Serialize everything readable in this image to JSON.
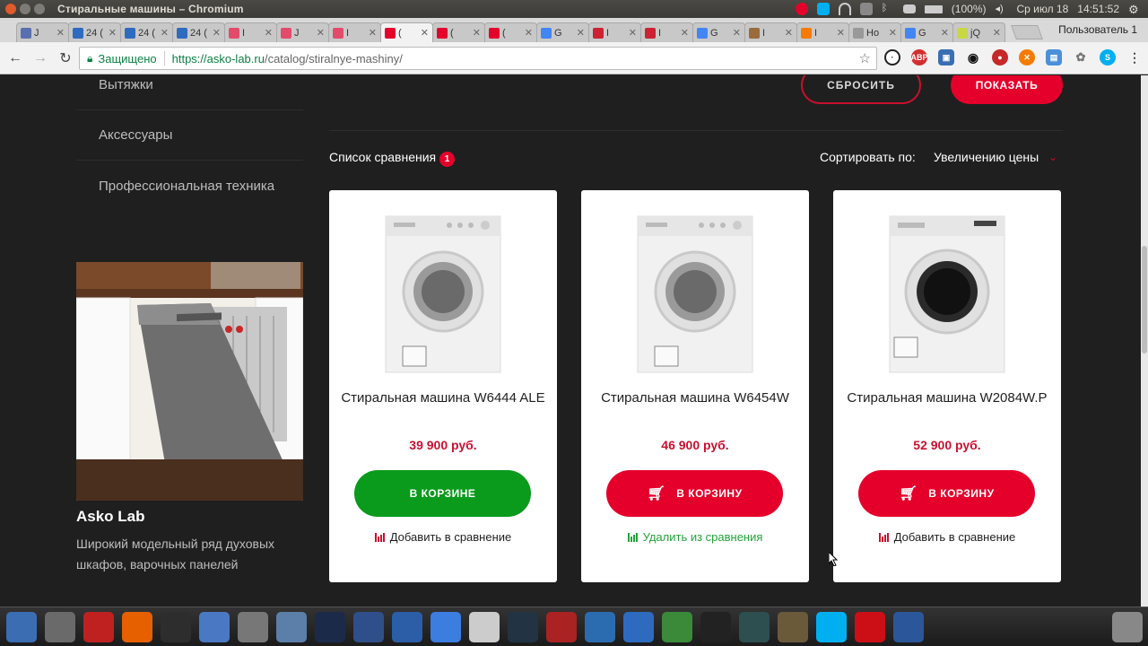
{
  "os": {
    "window_title": "Стиральные машины – Chromium",
    "battery": "(100%)",
    "datetime": "Ср июл 18   14:51:52"
  },
  "browser": {
    "tabs": [
      {
        "label": "J",
        "icon": "pause-icon",
        "color": "#5a6fb0"
      },
      {
        "label": "24 (",
        "icon": "24-icon",
        "color": "#2e6bbf"
      },
      {
        "label": "24 (",
        "icon": "24-icon",
        "color": "#2e6bbf"
      },
      {
        "label": "24 (",
        "icon": "24-icon",
        "color": "#2e6bbf"
      },
      {
        "label": "I",
        "icon": "em-icon",
        "color": "#e34b6b"
      },
      {
        "label": "J",
        "icon": "em-icon",
        "color": "#e34b6b"
      },
      {
        "label": "I",
        "icon": "em-icon",
        "color": "#e34b6b"
      },
      {
        "label": "(",
        "icon": "asko-icon",
        "color": "#e5002b",
        "active": true
      },
      {
        "label": "(",
        "icon": "asko-icon",
        "color": "#e5002b"
      },
      {
        "label": "(",
        "icon": "asko-icon",
        "color": "#e5002b"
      },
      {
        "label": "G",
        "icon": "google-icon",
        "color": "#4285f4"
      },
      {
        "label": "I",
        "icon": "opera-icon",
        "color": "#cc2233"
      },
      {
        "label": "I",
        "icon": "opera-icon",
        "color": "#cc2233"
      },
      {
        "label": "G",
        "icon": "google-icon",
        "color": "#4285f4"
      },
      {
        "label": "I",
        "icon": "cup-icon",
        "color": "#9b6b3a"
      },
      {
        "label": "I",
        "icon": "orange-icon",
        "color": "#f57c00"
      },
      {
        "label": "Ho",
        "icon": "none",
        "color": "#999"
      },
      {
        "label": "G",
        "icon": "google-icon",
        "color": "#4285f4"
      },
      {
        "label": "jQ",
        "icon": "jq-icon",
        "color": "#c9d743"
      }
    ],
    "profile_label": "Пользователь 1",
    "secure_label": "Защищено",
    "url_host": "https://asko-lab.ru",
    "url_path": "/catalog/stiralnye-mashiny/"
  },
  "sidebar": {
    "links": [
      "Вытяжки",
      "Аксессуары",
      "Профессиональная техника"
    ],
    "promo_title": "Asko Lab",
    "promo_text": "Широкий модельный ряд духовых шкафов, варочных панелей"
  },
  "filters": {
    "reset_label": "СБРОСИТЬ",
    "show_label": "ПОКАЗАТЬ"
  },
  "toolbar": {
    "compare_label": "Список сравнения",
    "compare_count": "1",
    "sort_label": "Сортировать по:",
    "sort_value": "Увеличению цены"
  },
  "products": [
    {
      "name": "Стиральная машина W6444 ALE",
      "price": "39 900 руб.",
      "button": "В КОРЗИНЕ",
      "in_cart": true,
      "compare": "Добавить в сравнение",
      "compared": false
    },
    {
      "name": "Стиральная машина W6454W",
      "price": "46 900 руб.",
      "button": "В КОРЗИНУ",
      "in_cart": false,
      "compare": "Удалить из сравнения",
      "compared": true
    },
    {
      "name": "Стиральная машина W2084W.P",
      "price": "52 900 руб.",
      "button": "В КОРЗИНУ",
      "in_cart": false,
      "compare": "Добавить в сравнение",
      "compared": false
    }
  ],
  "dock": [
    {
      "icon": "ubuntu-icon",
      "color": "#3b6db3"
    },
    {
      "icon": "calculator-icon",
      "color": "#6a6a6a"
    },
    {
      "icon": "filezilla-icon",
      "color": "#bf2121"
    },
    {
      "icon": "firefox-icon",
      "color": "#e66000"
    },
    {
      "icon": "terminal-icon",
      "color": "#2d2d2d"
    },
    {
      "icon": "document-icon",
      "color": "#4a78c2"
    },
    {
      "icon": "scanner-icon",
      "color": "#777"
    },
    {
      "icon": "tool-icon",
      "color": "#5b7fa8"
    },
    {
      "icon": "photoshop-icon",
      "color": "#1c2a4a"
    },
    {
      "icon": "pen-icon",
      "color": "#2f4f8a"
    },
    {
      "icon": "blue-swirl-icon",
      "color": "#2c5ea8"
    },
    {
      "icon": "chromium-icon",
      "color": "#3c7de0"
    },
    {
      "icon": "editor-icon",
      "color": "#ccc"
    },
    {
      "icon": "monitor-icon",
      "color": "#234"
    },
    {
      "icon": "red-swirl-icon",
      "color": "#a22"
    },
    {
      "icon": "system-monitor-icon",
      "color": "#2b6cb0"
    },
    {
      "icon": "24-icon",
      "color": "#2e6bbf"
    },
    {
      "icon": "spreadsheet-icon",
      "color": "#3a8a3a"
    },
    {
      "icon": "inkscape-icon",
      "color": "#222"
    },
    {
      "icon": "gimp-icon",
      "color": "#2d4f4f"
    },
    {
      "icon": "wine-icon",
      "color": "#6b5a3a"
    },
    {
      "icon": "skype-icon",
      "color": "#00aff0"
    },
    {
      "icon": "opera-icon",
      "color": "#cc0f16"
    },
    {
      "icon": "word-icon",
      "color": "#2b579a"
    },
    {
      "icon": "trash-icon",
      "color": "#888"
    }
  ]
}
